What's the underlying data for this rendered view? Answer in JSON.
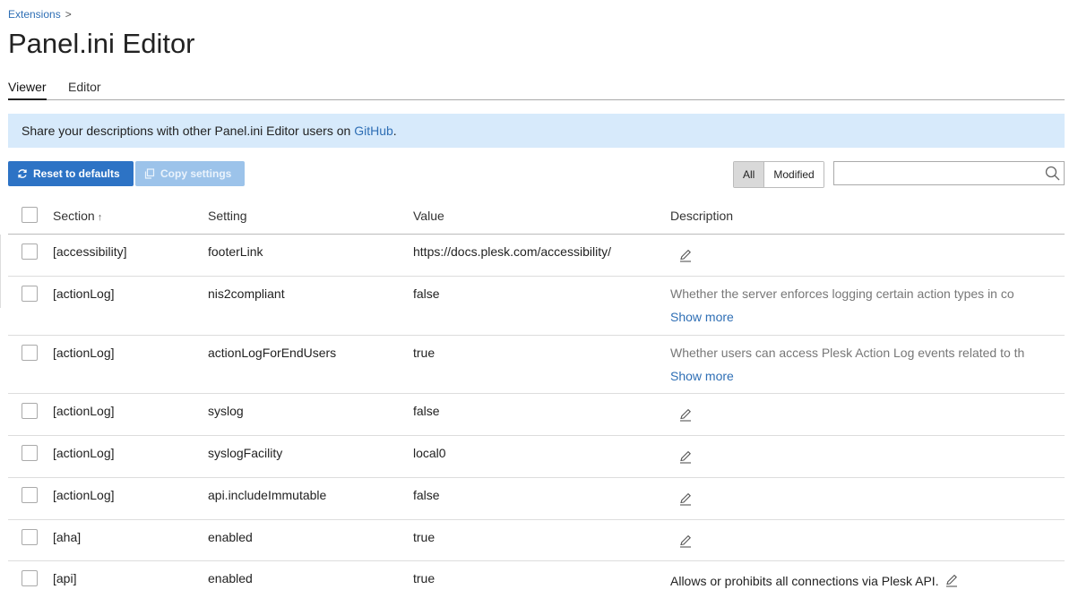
{
  "breadcrumb": {
    "item": "Extensions",
    "separator": ">"
  },
  "page_title": "Panel.ini Editor",
  "tabs": [
    {
      "label": "Viewer",
      "active": true
    },
    {
      "label": "Editor",
      "active": false
    }
  ],
  "banner": {
    "text_before": "Share your descriptions with other Panel.ini Editor users on ",
    "link": "GitHub",
    "text_after": "."
  },
  "toolbar": {
    "reset_label": "Reset to defaults",
    "copy_label": "Copy settings",
    "filter_all": "All",
    "filter_modified": "Modified",
    "search_value": ""
  },
  "table": {
    "headers": {
      "section": "Section",
      "sort_indicator": "↑",
      "setting": "Setting",
      "value": "Value",
      "description": "Description"
    },
    "rows": [
      {
        "section": "[accessibility]",
        "setting": "footerLink",
        "value": "https://docs.plesk.com/accessibility/",
        "description": "",
        "show_more": ""
      },
      {
        "section": "[actionLog]",
        "setting": "nis2compliant",
        "value": "false",
        "description": "Whether the server enforces logging certain action types in co",
        "show_more": "Show more"
      },
      {
        "section": "[actionLog]",
        "setting": "actionLogForEndUsers",
        "value": "true",
        "description": "Whether users can access Plesk Action Log events related to th",
        "show_more": "Show more"
      },
      {
        "section": "[actionLog]",
        "setting": "syslog",
        "value": "false",
        "description": "",
        "show_more": ""
      },
      {
        "section": "[actionLog]",
        "setting": "syslogFacility",
        "value": "local0",
        "description": "",
        "show_more": ""
      },
      {
        "section": "[actionLog]",
        "setting": "api.includeImmutable",
        "value": "false",
        "description": "",
        "show_more": ""
      },
      {
        "section": "[aha]",
        "setting": "enabled",
        "value": "true",
        "description": "",
        "show_more": ""
      },
      {
        "section": "[api]",
        "setting": "enabled",
        "value": "true",
        "description": "Allows or prohibits all connections via Plesk API.",
        "show_more": ""
      }
    ]
  },
  "colors": {
    "accent": "#2d73c5",
    "link": "#2f6fb5",
    "banner_bg": "#d7eafb"
  }
}
